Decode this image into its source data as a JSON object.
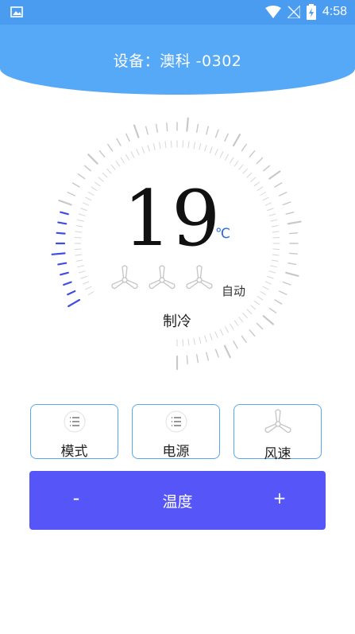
{
  "status_bar": {
    "time": "4:58"
  },
  "header": {
    "title": "设备：澳科 -0302"
  },
  "thermostat": {
    "temperature": "19",
    "unit": "℃",
    "fan_mode": "自动",
    "mode": "制冷",
    "active_level_fraction": 0.15
  },
  "controls": {
    "mode_label": "模式",
    "power_label": "电源",
    "fan_speed_label": "风速"
  },
  "temp_bar": {
    "minus_label": "-",
    "label": "温度",
    "plus_label": "+"
  },
  "colors": {
    "status_bar": "#4a9cf1",
    "header": "#55a9f7",
    "accent": "#5655f8",
    "active_tick": "#3f4de0",
    "tick": "#c8c8c8",
    "button_border": "#5aa5f0"
  },
  "icons": {
    "status_left": "gallery-icon",
    "wifi": "wifi-icon",
    "signal": "no-signal-icon",
    "battery": "battery-charging-icon",
    "fan": "fan-icon",
    "menu": "menu-list-icon"
  }
}
